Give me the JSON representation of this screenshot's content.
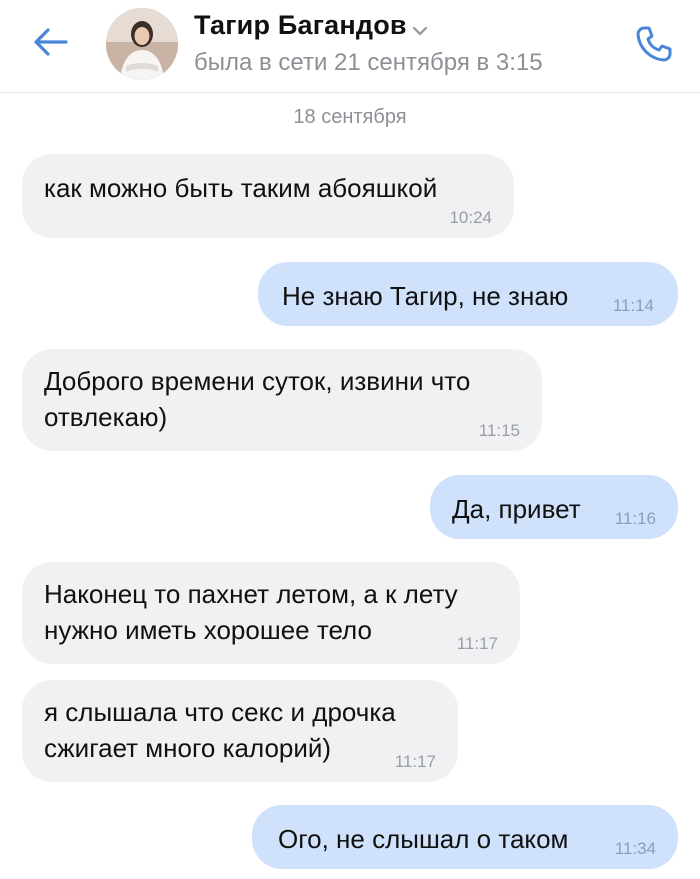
{
  "header": {
    "contact_name": "Тагир Багандов",
    "status": "была в сети 21 сентября в 3:15"
  },
  "date_separator": "18 сентября",
  "messages": [
    {
      "direction": "in",
      "text": "как можно быть таким абояшкой",
      "time": "10:24"
    },
    {
      "direction": "out",
      "text": "Не знаю Тагир, не знаю",
      "time": "11:14"
    },
    {
      "direction": "in",
      "text": "Доброго времени суток, извини что\nотвлекаю)",
      "time": "11:15"
    },
    {
      "direction": "out",
      "text": "Да, привет",
      "time": "11:16"
    },
    {
      "direction": "in",
      "text": "Наконец то пахнет летом, а к лету\nнужно иметь хорошее тело",
      "time": "11:17"
    },
    {
      "direction": "in",
      "text": "я слышала что секс и дрочка\nсжигает много калорий)",
      "time": "11:17"
    },
    {
      "direction": "out",
      "text": "Ого, не слышал о таком",
      "time": "11:34"
    }
  ],
  "icons": {
    "back": "arrow-left-icon",
    "call": "phone-icon",
    "chevron": "chevron-down-icon"
  },
  "colors": {
    "accent": "#4a86d8",
    "incoming_bubble": "#f0f1f3",
    "outgoing_bubble": "#cfe1fb"
  }
}
